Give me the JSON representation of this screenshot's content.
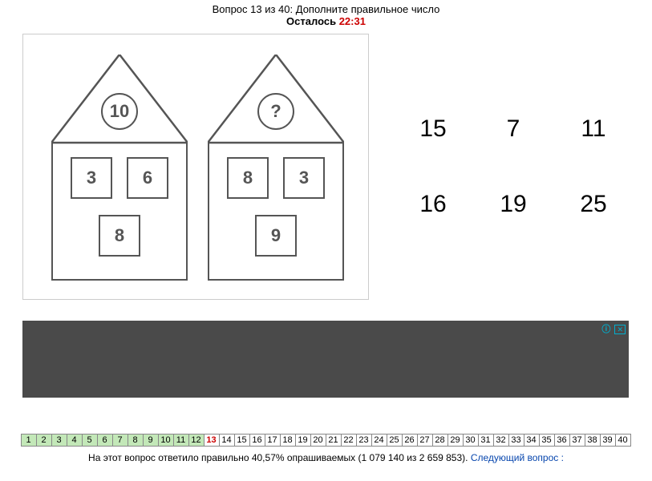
{
  "header": {
    "question_prefix": "Вопрос ",
    "question_num": "13",
    "question_of": " из 40: ",
    "question_text": "Дополните правильное число",
    "timer_label": "Осталось ",
    "timer_value": "22:31"
  },
  "puzzle": {
    "house1": {
      "roof": "10",
      "a": "3",
      "b": "6",
      "c": "8"
    },
    "house2": {
      "roof": "?",
      "a": "8",
      "b": "3",
      "c": "9"
    }
  },
  "answers": [
    "15",
    "7",
    "11",
    "16",
    "19",
    "25"
  ],
  "ad": {
    "info_glyph": "ⓘ",
    "close_glyph": "✕"
  },
  "nav": {
    "total": 40,
    "current": 13,
    "answered_through": 12
  },
  "footer": {
    "stats": "На этот вопрос ответило правильно 40,57% опрашиваемых (1 079 140 из 2 659 853). ",
    "next_label": "Следующий вопрос :"
  }
}
